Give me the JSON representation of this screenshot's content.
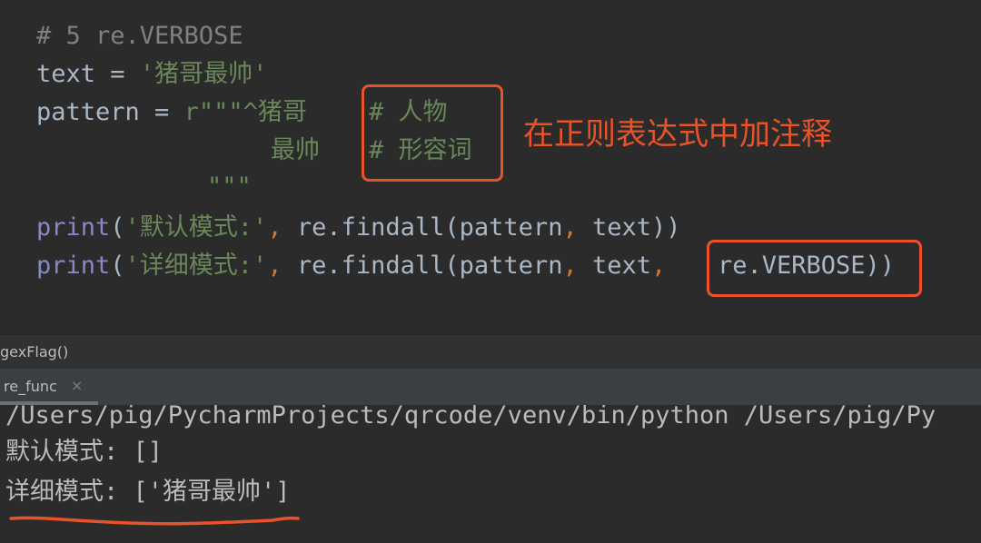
{
  "editor": {
    "lines": {
      "comment": "# 5 re.VERBOSE",
      "text_var": "text",
      "eq": " = ",
      "text_value": "'猪哥最帅'",
      "pattern_var": "pattern",
      "pattern_prefix": "r\"\"\"^猪哥    ",
      "pattern_comment1": "# 人物",
      "pattern_line2": "最帅    ",
      "pattern_comment2": "# 形容词",
      "pattern_close": "\"\"\"",
      "print": "print",
      "paren_open": "(",
      "label_default": "'默认模式:'",
      "label_verbose": "'详细模式:'",
      "comma": ",",
      "findall": " re.findall(pattern",
      "text_arg": " text",
      "close1": "))",
      "verbose_flag": "re.VERBOSE))"
    },
    "annotation": "在正则表达式中加注释"
  },
  "breadcrumb": {
    "text": "gexFlag()"
  },
  "run_panel": {
    "tab_label": "re_func",
    "tab_close_icon": "×"
  },
  "console": {
    "command": "/Users/pig/PycharmProjects/qrcode/venv/bin/python /Users/pig/Py",
    "output_default": "默认模式: []",
    "output_verbose": "详细模式: ['猪哥最帅']"
  },
  "colors": {
    "highlight": "#e8532a",
    "string": "#6a8759",
    "builtin": "#8888c6",
    "comment": "#808080"
  }
}
